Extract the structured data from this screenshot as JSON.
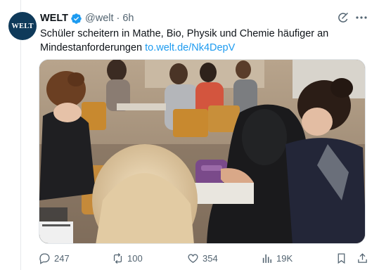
{
  "account": {
    "avatar_text": "WELT",
    "name": "WELT",
    "handle": "@welt",
    "separator": "·",
    "time": "6h",
    "avatar_color": "#0f3a5a",
    "verified_color": "#1d9bf0"
  },
  "tweet": {
    "text": "Schüler scheitern in Mathe, Bio, Physik und Chemie häufiger an Mindestanforderungen ",
    "link": "to.welt.de/Nk4DepV"
  },
  "media": {
    "icon": "photo-classroom-students"
  },
  "actions": {
    "reply_count": "247",
    "retweet_count": "100",
    "like_count": "354",
    "views_count": "19K"
  },
  "colors": {
    "link": "#1d9bf0",
    "muted": "#536471"
  }
}
